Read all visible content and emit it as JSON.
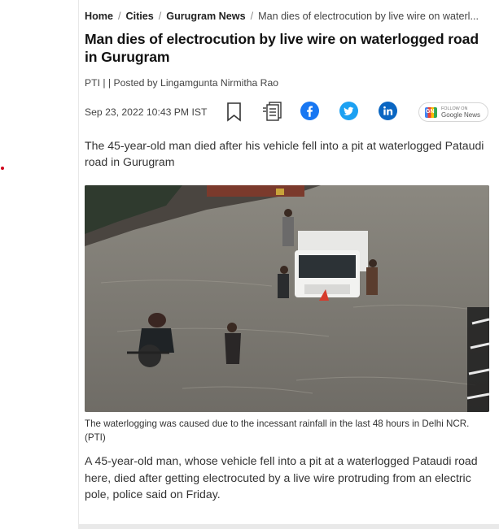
{
  "breadcrumb": {
    "items": [
      "Home",
      "Cities",
      "Gurugram News"
    ],
    "current": "Man dies of electrocution by live wire on waterl..."
  },
  "article": {
    "title": "Man dies of electrocution by live wire on waterlogged road in Gurugram",
    "byline": "PTI | | Posted by Lingamgunta Nirmitha Rao",
    "date": "Sep 23, 2022 10:43 PM IST",
    "summary": "The 45-year-old man died after his vehicle fell into a pit at waterlogged Pataudi road in Gurugram",
    "image_caption": "The waterlogging was caused due to the incessant rainfall in the last 48 hours in Delhi NCR. (PTI)",
    "body": "A 45-year-old man, whose vehicle fell into a pit at a waterlogged Pataudi road here, died after getting electrocuted by a live wire protruding from an electric pole, police said on Friday."
  },
  "share": {
    "icons": [
      "bookmark-icon",
      "read-list-icon",
      "facebook-icon",
      "twitter-icon",
      "linkedin-icon"
    ],
    "google_news_top": "FOLLOW ON",
    "google_news_bottom": "Google News"
  },
  "colors": {
    "facebook": "#1877f2",
    "twitter": "#1da1f2",
    "linkedin": "#0a66c2",
    "accent_dot": "#d0021b"
  }
}
